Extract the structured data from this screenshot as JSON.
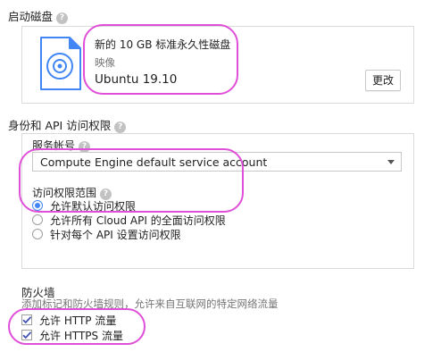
{
  "boot_disk": {
    "section_title": "启动磁盘",
    "disk_name": "新的 10 GB 标准永久性磁盘",
    "image_label": "映像",
    "image_value": "Ubuntu 19.10",
    "change_button": "更改"
  },
  "identity": {
    "section_title": "身份和 API 访问权限",
    "service_account_label": "服务帐号",
    "service_account_value": "Compute Engine default service account",
    "scope_label": "访问权限范围",
    "scope_options": [
      {
        "label": "允许默认访问权限",
        "selected": true
      },
      {
        "label": "允许所有 Cloud API 的全面访问权限",
        "selected": false
      },
      {
        "label": "针对每个 API 设置访问权限",
        "selected": false
      }
    ]
  },
  "firewall": {
    "section_title": "防火墙",
    "description": "添加标记和防火墙规则，允许来自互联网的特定网络流量",
    "options": [
      {
        "label": "允许 HTTP 流量",
        "checked": true
      },
      {
        "label": "允许 HTTPS 流量",
        "checked": true
      }
    ]
  },
  "colors": {
    "highlight": "#e04fd8",
    "accent": "#4285f4",
    "check": "#3f51b5"
  },
  "icons": [
    "help-icon",
    "disk-icon",
    "dropdown-caret-icon",
    "radio-icon",
    "checkbox-icon"
  ]
}
